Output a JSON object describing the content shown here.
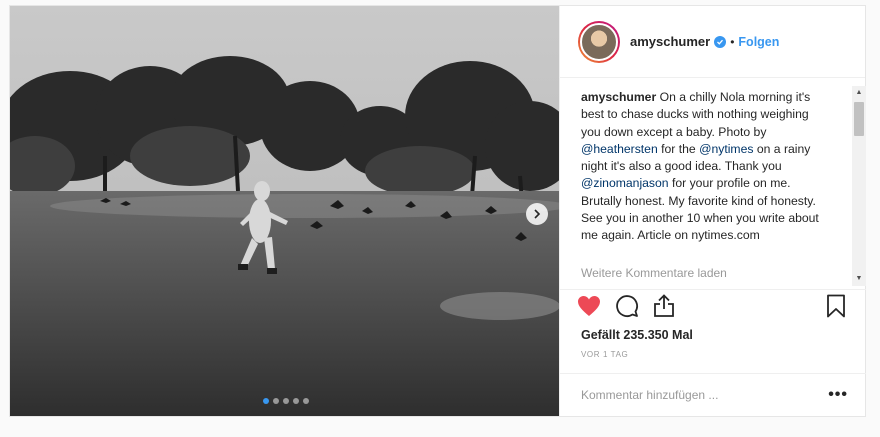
{
  "post": {
    "username": "amyschumer",
    "follow_label": "Folgen",
    "separator": "•",
    "caption": {
      "username": "amyschumer",
      "parts": [
        "On a chilly Nola morning it's best to chase ducks with nothing weighing you down except a baby. Photo by ",
        "@heathersten",
        " for the ",
        "@nytimes",
        " on a rainy night it's also a good idea. Thank you ",
        "@zinomanjason",
        " for your profile on me. Brutally honest. My favorite kind of honesty. See you in another 10 when you write about me again. Article on nytimes.com"
      ]
    },
    "load_more_comments": "Weitere Kommentare laden",
    "likes": "Gefällt 235.350 Mal",
    "timestamp": "VOR 1 TAG",
    "comment_placeholder": "Kommentar hinzufügen ...",
    "options_glyph": "•••",
    "carousel": {
      "count": 5,
      "active": 0
    }
  },
  "icons": {
    "like": "heart-icon",
    "comment": "comment-icon",
    "share": "share-icon",
    "save": "bookmark-icon",
    "verified": "verified-badge-icon",
    "next": "chevron-right-icon"
  },
  "colors": {
    "accent": "#3897f0",
    "heart": "#ed4956",
    "mention": "#003569",
    "muted": "#999999"
  }
}
